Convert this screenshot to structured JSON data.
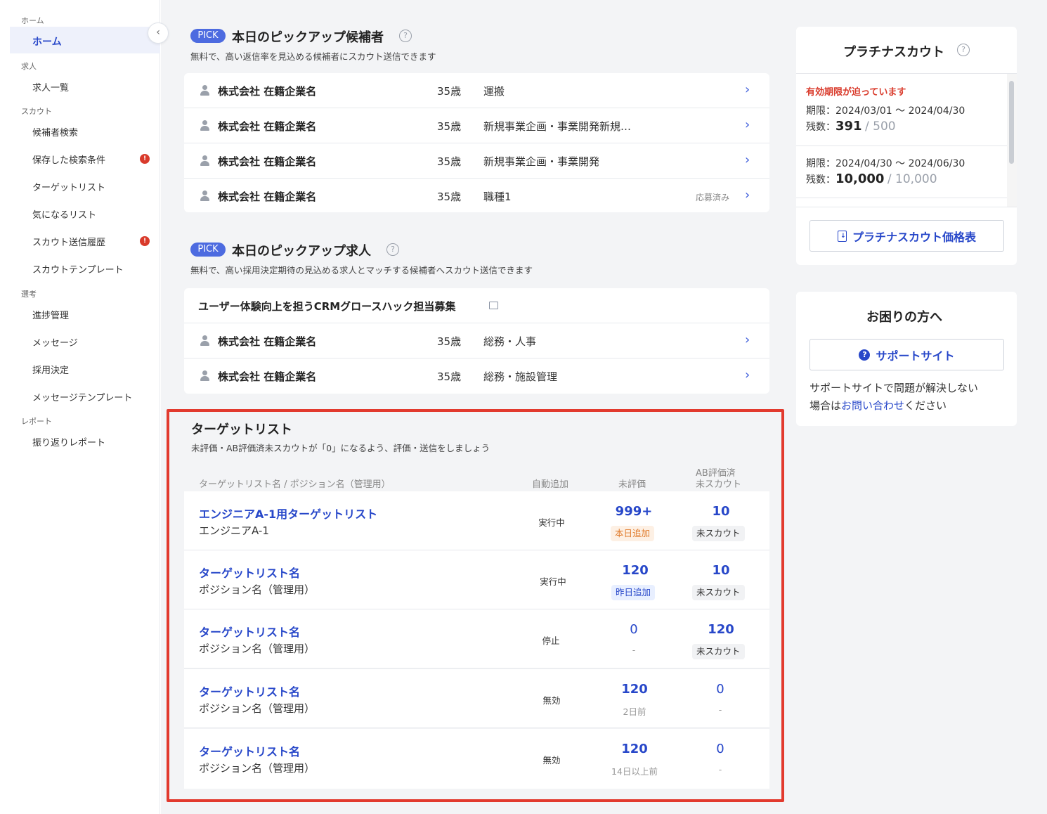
{
  "sidebar": {
    "sections": [
      {
        "label": "ホーム"
      },
      {
        "label": "求人"
      },
      {
        "label": "スカウト"
      },
      {
        "label": "選考"
      },
      {
        "label": "レポート"
      }
    ],
    "items": [
      {
        "label": "ホーム",
        "active": true
      },
      {
        "label": "求人一覧"
      },
      {
        "label": "候補者検索"
      },
      {
        "label": "保存した検索条件",
        "badge": "!"
      },
      {
        "label": "ターゲットリスト"
      },
      {
        "label": "気になるリスト"
      },
      {
        "label": "スカウト送信履歴",
        "badge": "!"
      },
      {
        "label": "スカウトテンプレート"
      },
      {
        "label": "進捗管理"
      },
      {
        "label": "メッセージ"
      },
      {
        "label": "採用決定"
      },
      {
        "label": "メッセージテンプレート"
      },
      {
        "label": "振り返りレポート"
      }
    ],
    "collapse_icon": "‹"
  },
  "pickup_candidates": {
    "badge": "PICK",
    "title": "本日のピックアップ候補者",
    "description": "無料で、高い返信率を見込める候補者にスカウト送信できます",
    "rows": [
      {
        "company": "株式会社 在籍企業名",
        "age": "35歳",
        "job": "運搬",
        "status": ""
      },
      {
        "company": "株式会社 在籍企業名",
        "age": "35歳",
        "job": "新規事業企画・事業開発新規…",
        "status": ""
      },
      {
        "company": "株式会社 在籍企業名",
        "age": "35歳",
        "job": "新規事業企画・事業開発",
        "status": ""
      },
      {
        "company": "株式会社 在籍企業名",
        "age": "35歳",
        "job": "職種1",
        "status": "応募済み"
      }
    ]
  },
  "pickup_jobs": {
    "badge": "PICK",
    "title": "本日のピックアップ求人",
    "description": "無料で、高い採用決定期待の見込める求人とマッチする候補者へスカウト送信できます",
    "job_title": "ユーザー体験向上を担うCRMグロースハック担当募集",
    "rows": [
      {
        "company": "株式会社 在籍企業名",
        "age": "35歳",
        "job": "総務・人事"
      },
      {
        "company": "株式会社 在籍企業名",
        "age": "35歳",
        "job": "総務・施設管理"
      }
    ]
  },
  "target_list": {
    "title": "ターゲットリスト",
    "description": "未評価・AB評価済未スカウトが「0」になるよう、評価・送信をしましょう",
    "headers": {
      "name": "ターゲットリスト名 / ポジション名（管理用）",
      "auto_add": "自動追加",
      "unrated": "未評価",
      "ab_line1": "AB評価済",
      "ab_line2": "未スカウト"
    },
    "rows": [
      {
        "name": "エンジニアA-1用ターゲットリスト",
        "position": "エンジニアA-1",
        "status": "実行中",
        "unrated": "999+",
        "unrated_sub": "本日追加",
        "ab": "10",
        "ab_sub": "未スカウト"
      },
      {
        "name": "ターゲットリスト名",
        "position": "ポジション名（管理用）",
        "status": "実行中",
        "unrated": "120",
        "unrated_sub": "昨日追加",
        "ab": "10",
        "ab_sub": "未スカウト"
      },
      {
        "name": "ターゲットリスト名",
        "position": "ポジション名（管理用）",
        "status": "停止",
        "unrated": "0",
        "unrated_sub": "-",
        "ab": "120",
        "ab_sub": "未スカウト"
      },
      {
        "name": "ターゲットリスト名",
        "position": "ポジション名（管理用）",
        "status": "無効",
        "unrated": "120",
        "unrated_sub": "2日前",
        "ab": "0",
        "ab_sub": "-"
      },
      {
        "name": "ターゲットリスト名",
        "position": "ポジション名（管理用）",
        "status": "無効",
        "unrated": "120",
        "unrated_sub": "14日以上前",
        "ab": "0",
        "ab_sub": "-"
      }
    ]
  },
  "platinum": {
    "title": "プラチナスカウト",
    "warning": "有効期限が迫っています",
    "periods": [
      {
        "period_label": "期限：",
        "period": "2024/03/01 〜 2024/04/30",
        "remain_label": "残数：",
        "remain": "391",
        "total": "/ 500"
      },
      {
        "period_label": "期限：",
        "period": "2024/04/30 〜 2024/06/30",
        "remain_label": "残数：",
        "remain": "10,000",
        "total": "/ 10,000"
      }
    ],
    "price_button": "プラチナスカウト価格表"
  },
  "help": {
    "title": "お困りの方へ",
    "support_button": "サポートサイト",
    "text_before": "サポートサイトで問題が解決しない",
    "text_line2_before": "場合は",
    "link": "お問い合わせ",
    "text_after": "ください"
  },
  "colors": {
    "accent": "#2747c9",
    "pick": "#4d6be0",
    "alert": "#d93a2b",
    "highlight_frame": "#e23a2e"
  }
}
